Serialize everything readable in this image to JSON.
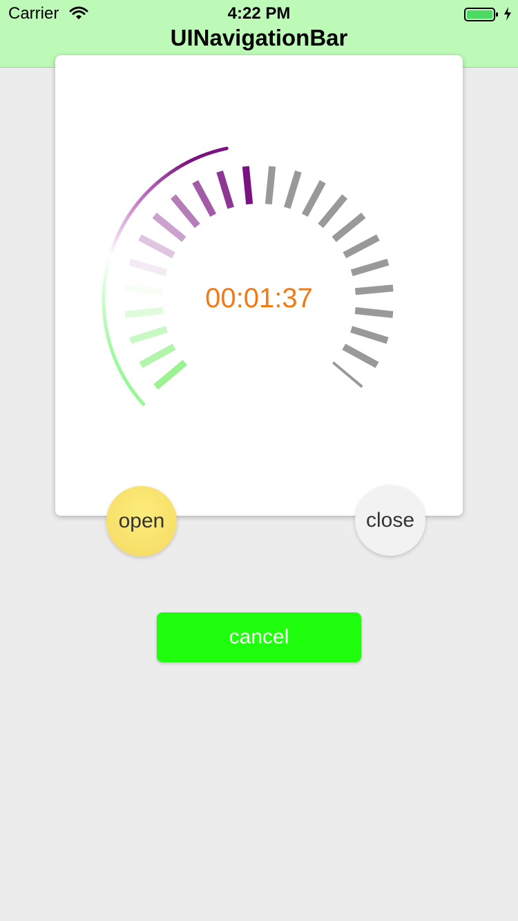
{
  "status_bar": {
    "carrier": "Carrier",
    "time": "4:22 PM"
  },
  "navbar": {
    "title": "UINavigationBar",
    "background": "#bdfab8"
  },
  "gauge": {
    "timer": "00:01:37",
    "timer_color": "#f27a14",
    "total_ticks": 24,
    "active_ticks": 12,
    "active_color_start": "#88f07e",
    "active_color_mid": "#ffffff",
    "active_color_end": "#7a137f",
    "inactive_color": "#999999"
  },
  "buttons": {
    "open": "open",
    "close": "close",
    "cancel": "cancel"
  },
  "icons": {
    "wifi": "wifi-icon",
    "battery": "battery-icon",
    "charging": "charging-bolt-icon"
  }
}
